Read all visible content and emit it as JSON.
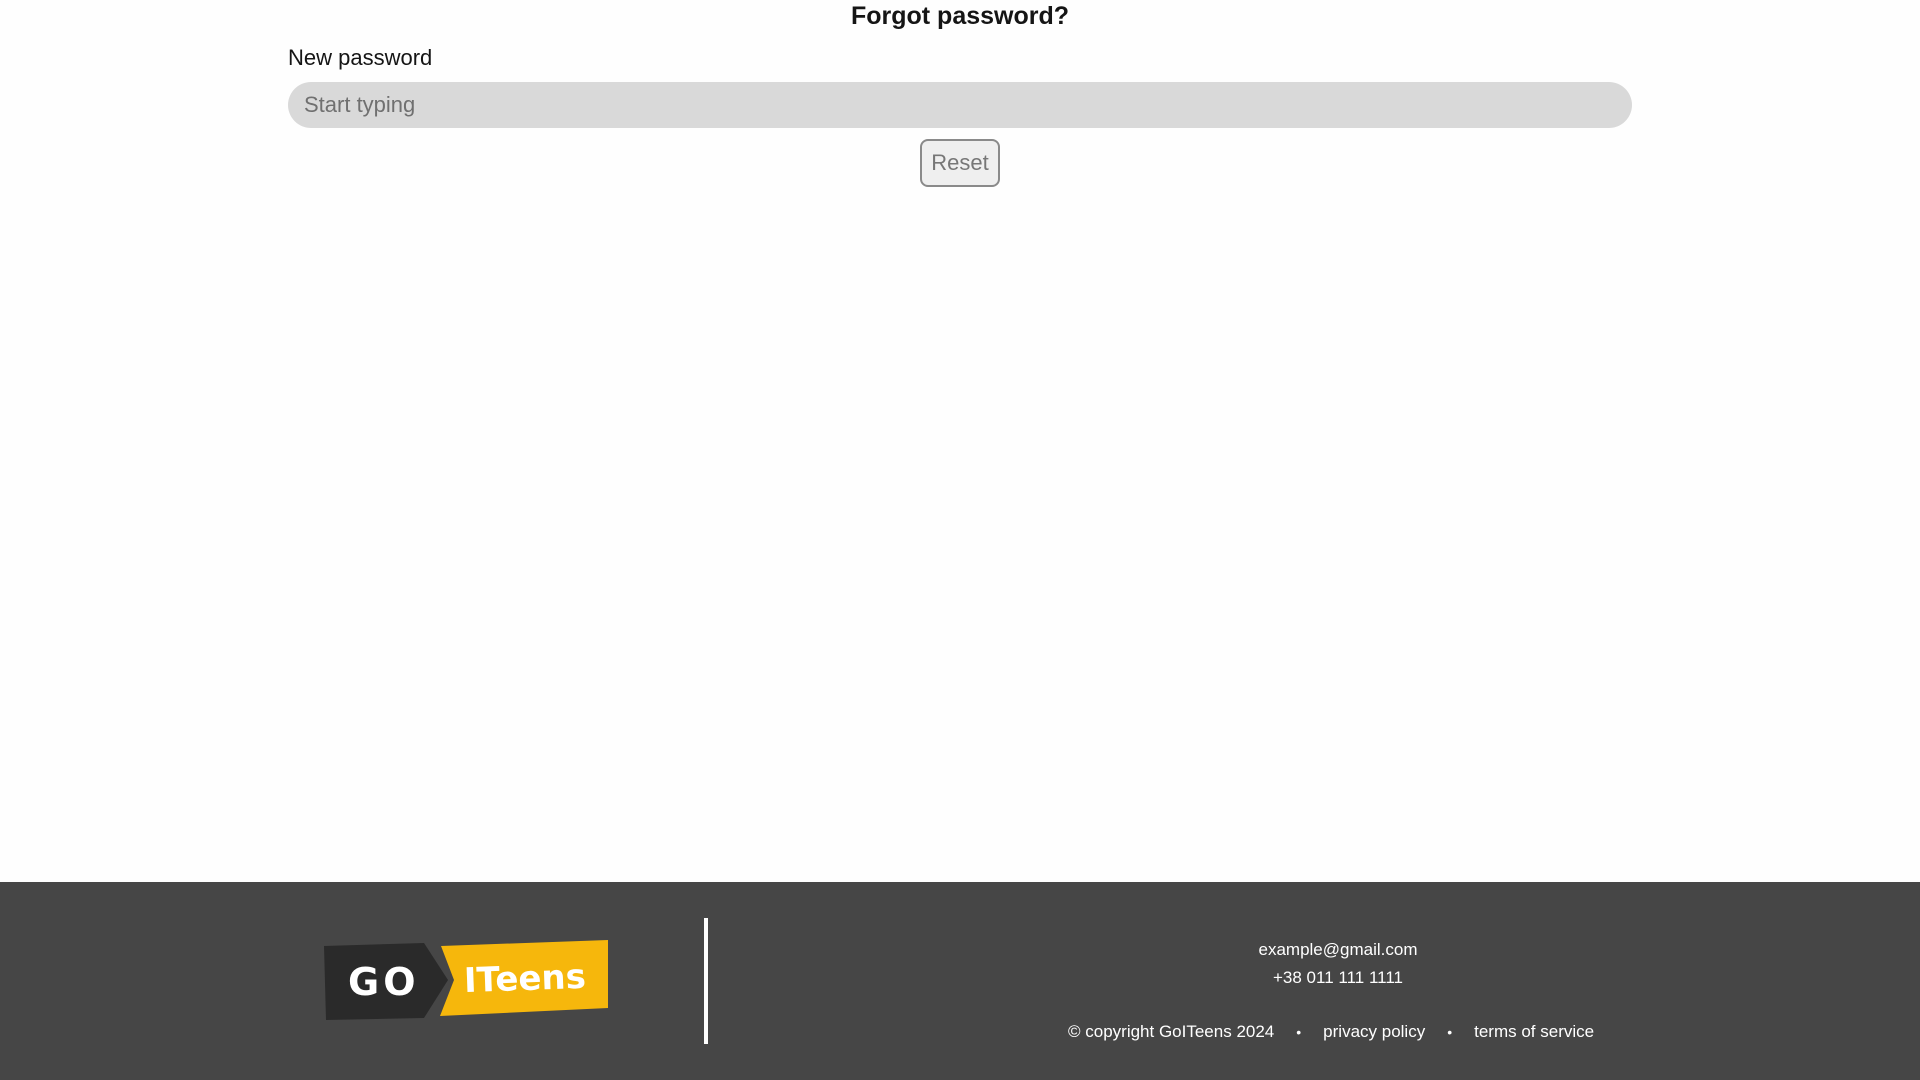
{
  "reset_form": {
    "title": "Forgot password?",
    "new_password_label": "New password",
    "new_password_placeholder": "Start typing",
    "new_password_value": "",
    "reset_label": "Reset"
  },
  "footer": {
    "logo": {
      "text_dark": "GO",
      "text_light": "ITeens",
      "dark_color": "#2a2a2a",
      "accent_color": "#f6b70c"
    },
    "email": "example@gmail.com",
    "phone": "+38 011 111 1111",
    "copyright": "© copyright GoITeens 2024",
    "separator": "•",
    "privacy_policy": "privacy policy",
    "terms_of_service": "terms of service"
  },
  "colors": {
    "page_bg": "#fefefe",
    "input_bg": "#d9d9d9",
    "footer_bg": "#464646"
  }
}
